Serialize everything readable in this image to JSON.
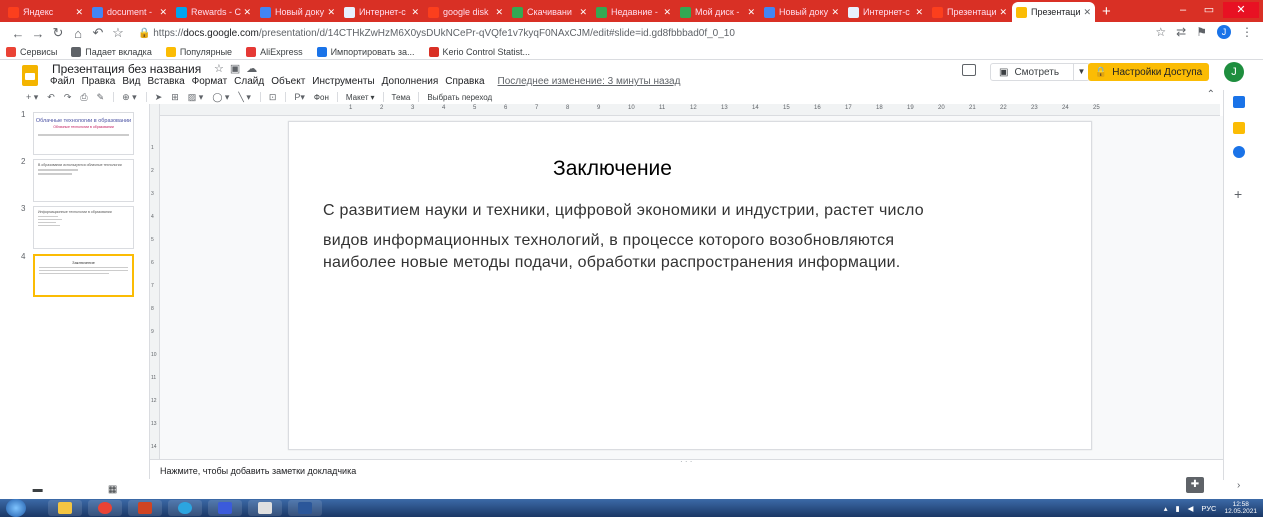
{
  "browser": {
    "tabs": [
      {
        "label": "Яндекс",
        "color": "#fc3f1d"
      },
      {
        "label": "document -",
        "color": "#4285f4"
      },
      {
        "label": "Rewards - С",
        "color": "#00a4ef"
      },
      {
        "label": "Новый доку",
        "color": "#4285f4"
      },
      {
        "label": "Интернет-с",
        "color": "#e8f0fe"
      },
      {
        "label": "google disk",
        "color": "#fc3f1d"
      },
      {
        "label": "Скачивани",
        "color": "#34a853"
      },
      {
        "label": "Недавние -",
        "color": "#34a853"
      },
      {
        "label": "Мой диск -",
        "color": "#34a853"
      },
      {
        "label": "Новый доку",
        "color": "#4285f4"
      },
      {
        "label": "Интернет-с",
        "color": "#e8f0fe"
      },
      {
        "label": "Презентаци",
        "color": "#fc3f1d"
      },
      {
        "label": "Презентаци",
        "color": "#fbbc04",
        "active": true
      }
    ],
    "new_tab": "+",
    "url_prefix": "https://",
    "url_host": "docs.google.com",
    "url_path": "/presentation/d/14CTHkZwHzM6X0ysDUkNCePr-qVQfe1v7kyqF0NAxCJM/edit#slide=id.gd8fbbbad0f_0_10",
    "user_initial": "J"
  },
  "bookmarks": [
    {
      "label": "Сервисы",
      "color": "#ea4335"
    },
    {
      "label": "Падает вкладка",
      "color": "#5f6368"
    },
    {
      "label": "Популярные",
      "color": "#fbbc04"
    },
    {
      "label": "AliExpress",
      "color": "#e53935"
    },
    {
      "label": "Импортировать за...",
      "color": "#1a73e8"
    },
    {
      "label": "Kerio Control Statist...",
      "color": "#d93025"
    }
  ],
  "app": {
    "doc_title": "Презентация без названия",
    "menu": [
      "Файл",
      "Правка",
      "Вид",
      "Вставка",
      "Формат",
      "Слайд",
      "Объект",
      "Инструменты",
      "Дополнения",
      "Справка"
    ],
    "last_edit": "Последнее изменение: 3 минуты назад",
    "present_label": "Смотреть",
    "share_label": "Настройки Доступа",
    "user_initial": "J"
  },
  "toolbar": {
    "background": "Фон",
    "layout": "Макет",
    "theme": "Тема",
    "transition": "Выбрать переход"
  },
  "filmstrip": [
    {
      "num": "1",
      "title": "Облачные технологии в образовании",
      "subtitle": "Облачные технологии в образовании"
    },
    {
      "num": "2",
      "title": "",
      "text": "В образовании используются облачные технологии"
    },
    {
      "num": "3",
      "title": "",
      "text": "Информационные технологии в образовании"
    },
    {
      "num": "4",
      "title": "Заключение",
      "selected": true
    }
  ],
  "slide": {
    "title": "Заключение",
    "line1": "С развитием науки и техники, цифровой экономики и индустрии, растет число",
    "line2": "видов информационных технологий, в процессе которого возобновляются",
    "line3": "наиболее новые методы подачи, обработки распространения информации."
  },
  "notes": {
    "placeholder": "Нажмите, чтобы добавить заметки докладчика"
  },
  "taskbar": {
    "lang": "РУС",
    "time": "12:58",
    "date": "12.05.2021"
  }
}
